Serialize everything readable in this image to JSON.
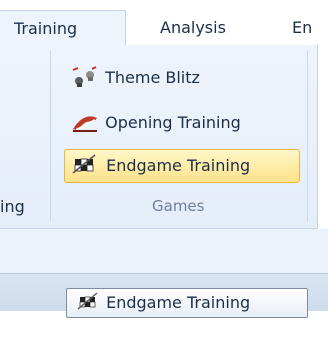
{
  "tabs": [
    {
      "label": "Training",
      "active": true
    },
    {
      "label": "Analysis",
      "active": false
    },
    {
      "label": "En",
      "active": false
    }
  ],
  "ribbon": {
    "left_group_label_fragment": "ing",
    "group_label": "Games",
    "commands": [
      {
        "label": "Theme Blitz",
        "icon": "theme-blitz-icon"
      },
      {
        "label": "Opening Training",
        "icon": "opening-training-icon"
      },
      {
        "label": "Endgame Training",
        "icon": "endgame-training-icon",
        "highlighted": true
      }
    ]
  },
  "tooltip": {
    "label": "Endgame Training",
    "icon": "endgame-training-icon"
  },
  "colors": {
    "highlight": "#ffe28a",
    "highlight_border": "#e7b649",
    "ribbon": "#eef4fb"
  }
}
